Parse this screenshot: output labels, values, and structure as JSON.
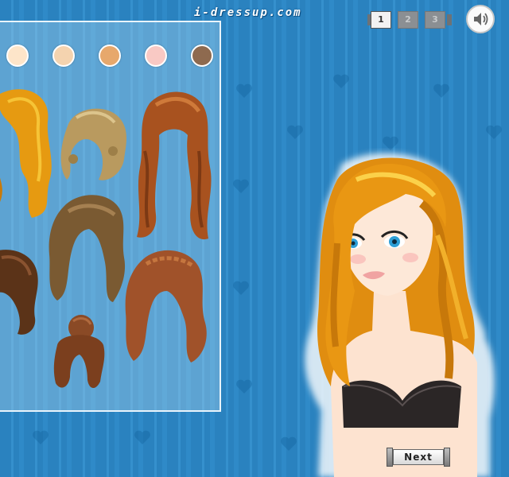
{
  "site": {
    "logo_text": "i-dressup.com"
  },
  "pagination": {
    "pages": [
      "1",
      "2",
      "3"
    ],
    "current": "1"
  },
  "icons": {
    "sound": "speaker-icon"
  },
  "actions": {
    "next_label": "Next"
  },
  "colors": {
    "background": "#2d86c3",
    "panel_border": "#e9f4fb",
    "skin_swatches": [
      "#fde5c9",
      "#f4d3af",
      "#e7a86c",
      "#f9c9c4",
      "#8e6a4f"
    ]
  },
  "hair_options": [
    "golden-wavy",
    "blonde-curly-short",
    "auburn-long-wavy",
    "brown-long-bangs",
    "dark-brown-wavy",
    "red-braided-wavy",
    "brown-updo-bun"
  ]
}
